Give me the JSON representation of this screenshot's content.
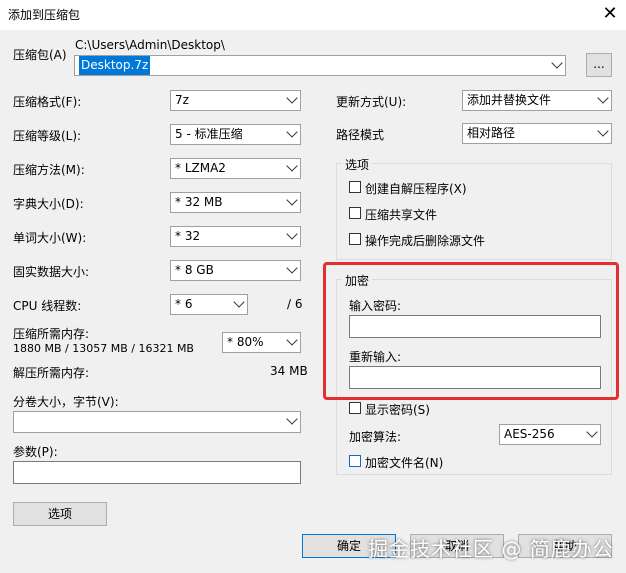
{
  "window": {
    "title": "添加到压缩包",
    "close_glyph": "✕"
  },
  "archive": {
    "label": "压缩包(A)",
    "path": "C:\\Users\\Admin\\Desktop\\",
    "name": "Desktop.7z",
    "browse_label": "..."
  },
  "left": {
    "format": {
      "label": "压缩格式(F):",
      "value": "7z"
    },
    "level": {
      "label": "压缩等级(L):",
      "value": "5 - 标准压缩"
    },
    "method": {
      "label": "压缩方法(M):",
      "value": "*  LZMA2"
    },
    "dict": {
      "label": "字典大小(D):",
      "value": "*  32 MB"
    },
    "word": {
      "label": "单词大小(W):",
      "value": "*  32"
    },
    "solid": {
      "label": "固实数据大小:",
      "value": "*  8 GB"
    },
    "threads": {
      "label": "CPU 线程数:",
      "value": "*  6",
      "max": "/ 6"
    },
    "mem_compress": {
      "label": "压缩所需内存:",
      "value": "1880 MB / 13057 MB / 16321 MB",
      "percent": "*  80%"
    },
    "mem_decompress": {
      "label": "解压所需内存:",
      "value": "34 MB"
    },
    "split": {
      "label": "分卷大小，字节(V):",
      "value": ""
    },
    "params": {
      "label": "参数(P):",
      "value": ""
    },
    "options_button": "选项"
  },
  "right": {
    "update": {
      "label": "更新方式(U):",
      "value": "添加并替换文件"
    },
    "pathmode": {
      "label": "路径模式",
      "value": "相对路径"
    },
    "options": {
      "title": "选项",
      "sfx": "创建自解压程序(X)",
      "shared": "压缩共享文件",
      "delete": "操作完成后删除源文件"
    },
    "encryption": {
      "title": "加密",
      "password_label": "输入密码:",
      "reenter_label": "重新输入:",
      "show_password": "显示密码(S)",
      "method_label": "加密算法:",
      "method_value": "AES-256",
      "encrypt_names": "加密文件名(N)"
    }
  },
  "buttons": {
    "ok": "确定",
    "cancel": "取消",
    "help": "帮助"
  },
  "watermark": "掘金技术社区 @ 简鹿办公",
  "colors": {
    "highlight": "#e42f2f",
    "selection": "#0078d7"
  }
}
